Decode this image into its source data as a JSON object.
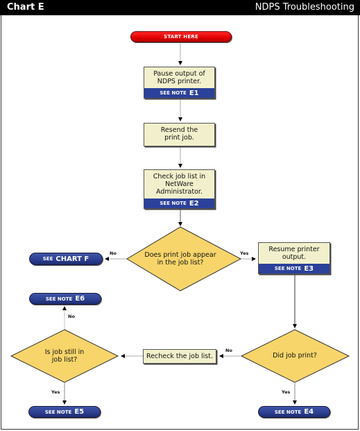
{
  "header": {
    "chart_label": "Chart E",
    "title": "NDPS Troubleshooting"
  },
  "colors": {
    "start_pill": "#e00000",
    "note_band": "#2b419a",
    "process_box": "#f2f0cc",
    "decision_diamond": "#f7d56b",
    "header_bg": "#000000"
  },
  "flow": {
    "start": {
      "label": "START HERE"
    },
    "step_pause": {
      "text": "Pause output of NDPS printer.",
      "note_prefix": "SEE NOTE",
      "note_id": "E1"
    },
    "step_resend": {
      "text": "Resend the print job."
    },
    "step_check": {
      "text": "Check job list in NetWare Administrator.",
      "note_prefix": "SEE NOTE",
      "note_id": "E2"
    },
    "decision_appear": {
      "text": "Does print job appear in the job list?",
      "no_label": "No",
      "yes_label": "Yes"
    },
    "end_chart_f": {
      "prefix": "SEE",
      "target": "CHART F"
    },
    "step_resume": {
      "text": "Resume printer output.",
      "note_prefix": "SEE NOTE",
      "note_id": "E3"
    },
    "decision_printed": {
      "text": "Did job print?",
      "no_label": "No",
      "yes_label": "Yes"
    },
    "end_e4": {
      "prefix": "SEE NOTE",
      "target": "E4"
    },
    "step_recheck": {
      "text": "Recheck the job list."
    },
    "decision_still": {
      "text": "Is job still in job list?",
      "no_label": "No",
      "yes_label": "Yes"
    },
    "end_e6": {
      "prefix": "SEE NOTE",
      "target": "E6"
    },
    "end_e5": {
      "prefix": "SEE NOTE",
      "target": "E5"
    }
  }
}
